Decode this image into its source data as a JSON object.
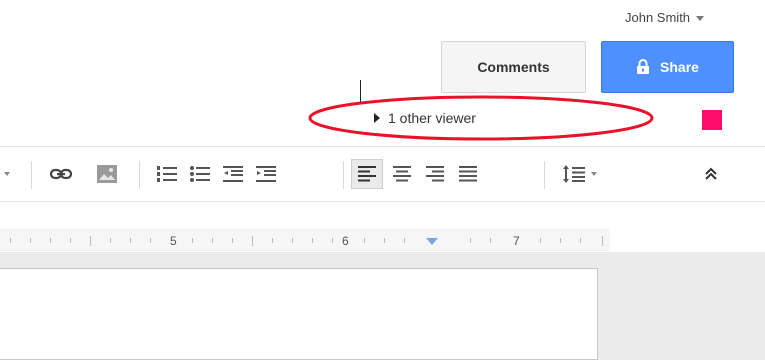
{
  "header": {
    "user_name": "John Smith",
    "comments_label": "Comments",
    "share_label": "Share"
  },
  "viewers": {
    "label": "1 other viewer"
  },
  "colors": {
    "accent_blue": "#4d90fe",
    "highlight_red": "#e8122a",
    "pink_marker": "#ff0f6b"
  },
  "toolbar": {
    "icons": [
      "link-icon",
      "image-icon",
      "numbered-list-icon",
      "bulleted-list-icon",
      "decrease-indent-icon",
      "increase-indent-icon",
      "align-left-icon",
      "align-center-icon",
      "align-right-icon",
      "justify-icon",
      "line-spacing-icon",
      "collapse-icon"
    ]
  },
  "ruler": {
    "numbers": [
      "5",
      "6",
      "7"
    ]
  }
}
